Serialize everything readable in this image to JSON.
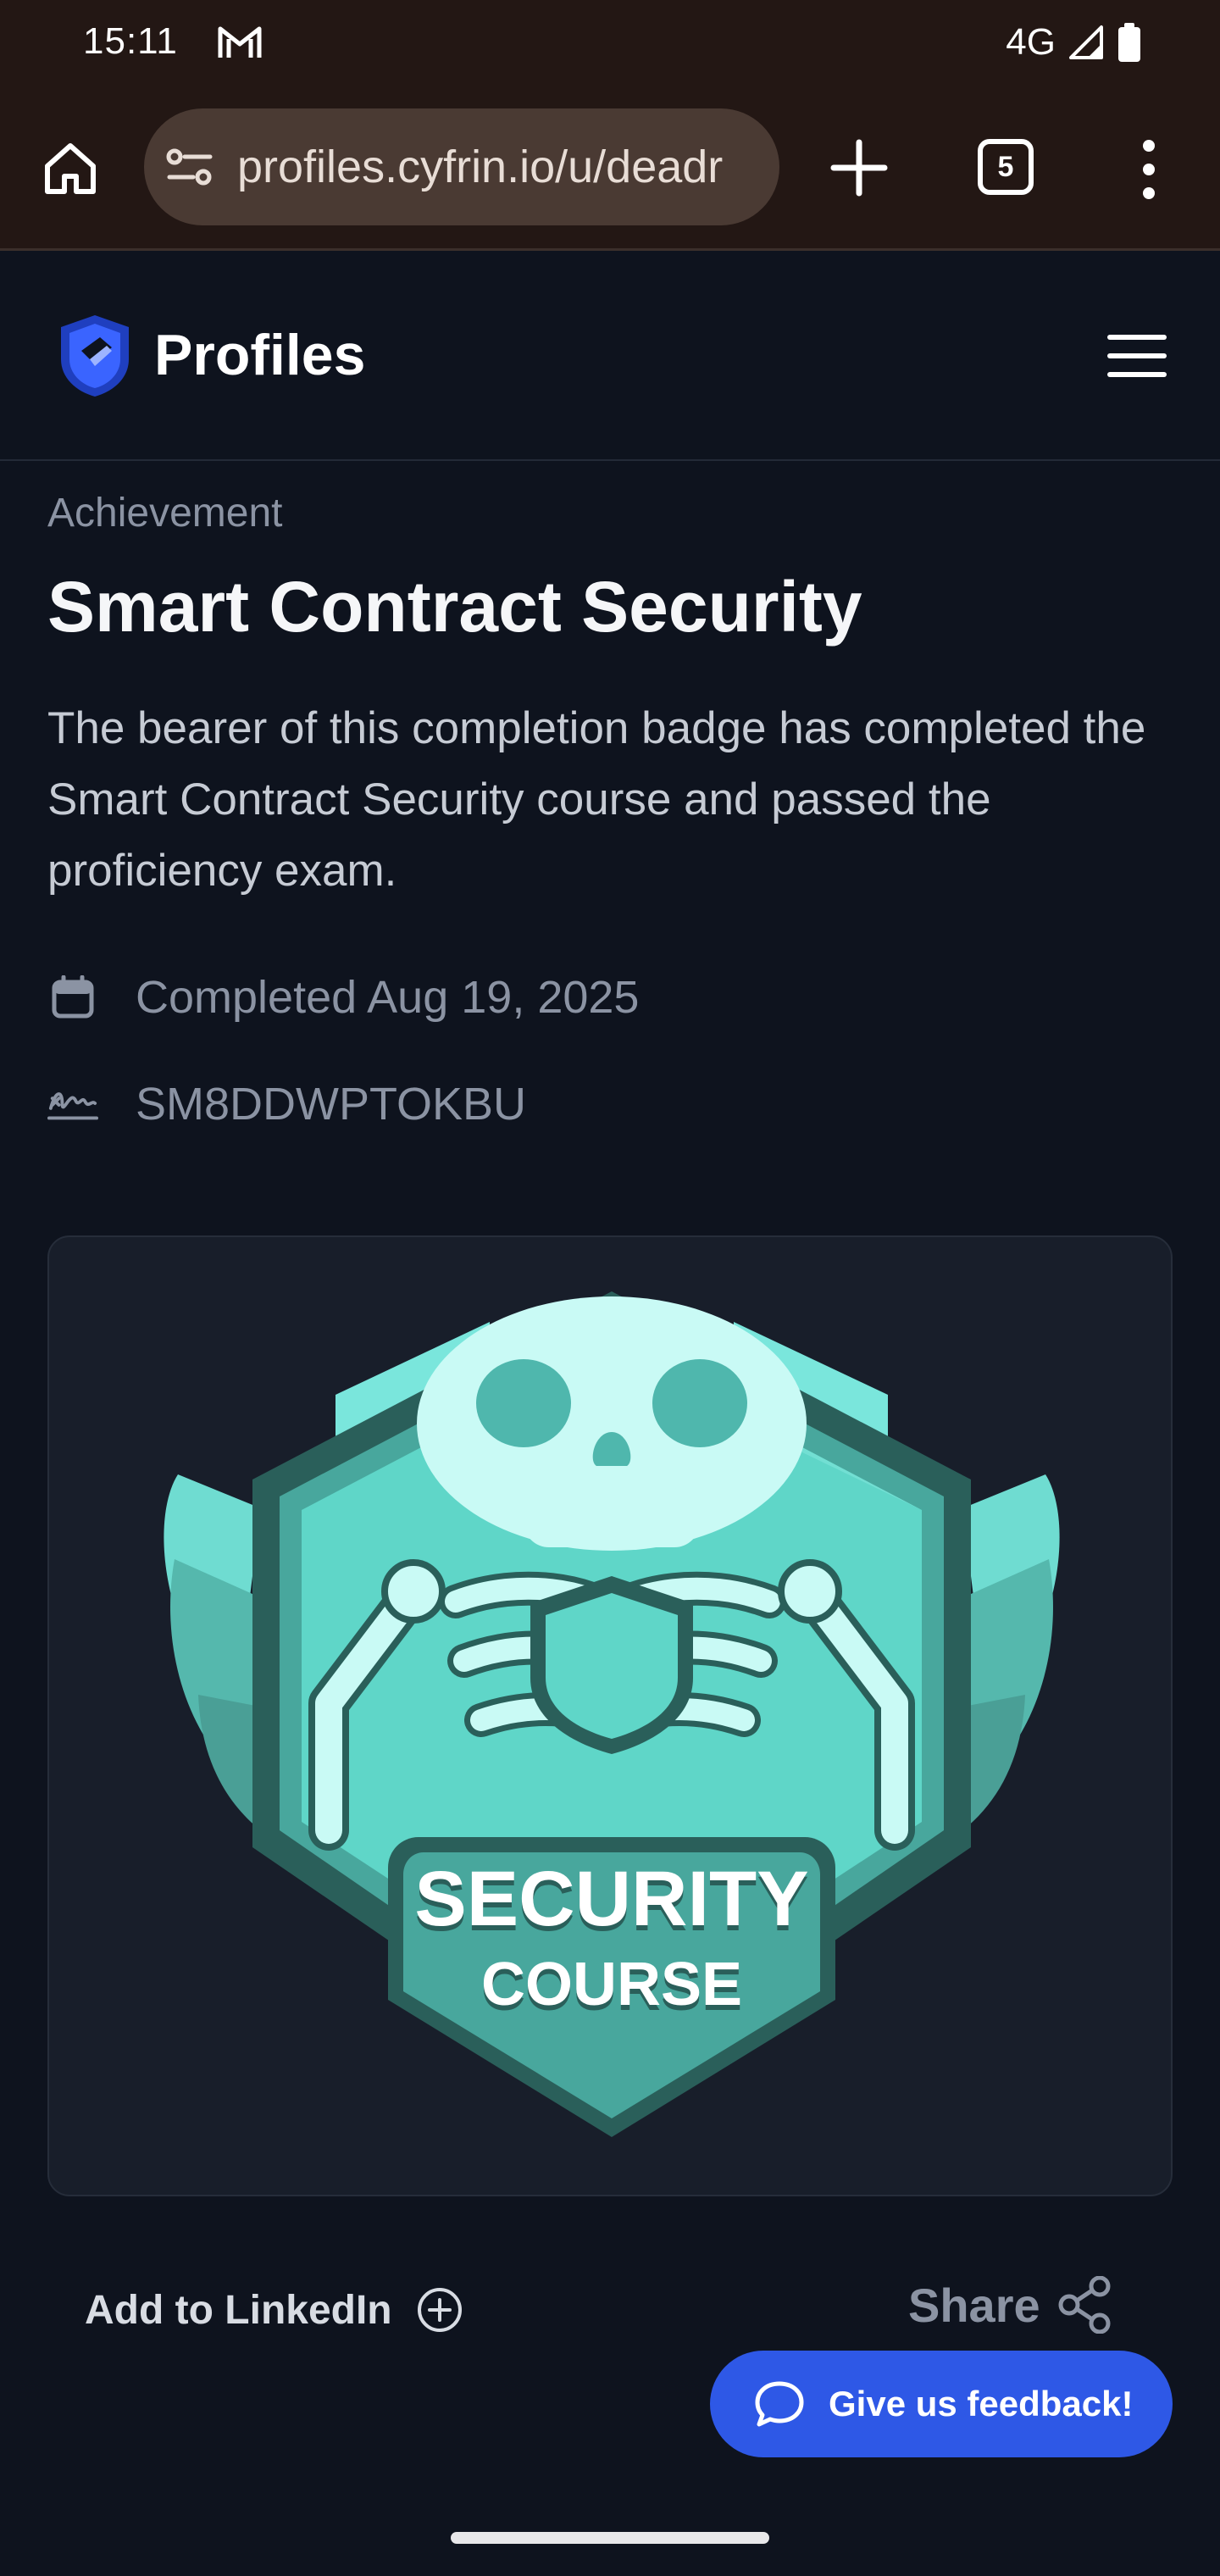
{
  "status_bar": {
    "time": "15:11",
    "network": "4G",
    "notification_icon": "gmail-icon",
    "icons": [
      "signal-icon",
      "battery-icon"
    ]
  },
  "browser": {
    "url": "profiles.cyfrin.io/u/deadr",
    "tab_count": "5",
    "icons": [
      "home-icon",
      "site-settings-icon",
      "new-tab-icon",
      "tab-switcher-icon",
      "more-vert-icon"
    ]
  },
  "header": {
    "logo_text": "Profiles",
    "menu_icon": "hamburger-menu-icon"
  },
  "achievement": {
    "eyebrow": "Achievement",
    "title": "Smart Contract Security",
    "description": "The bearer of this completion badge has completed the Smart Contract Security course and passed the proficiency exam.",
    "completed": "Completed Aug 19, 2025",
    "credential_id": "SM8DDWPTOKBU"
  },
  "badge": {
    "line1": "SECURITY",
    "line2": "COURSE"
  },
  "actions": {
    "linkedin": "Add to LinkedIn",
    "share": "Share",
    "feedback": "Give us feedback!"
  },
  "colors": {
    "background": "#0e131e",
    "card": "#181e2a",
    "accent": "#2e58e6",
    "badge_teal": "#5fd6c8",
    "badge_dark": "#2a6f68",
    "browser_chrome": "#231714"
  }
}
